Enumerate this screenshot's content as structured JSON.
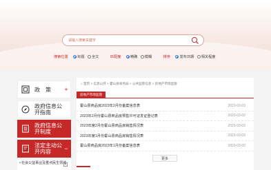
{
  "search": {
    "placeholder": "请输入搜索关键字"
  },
  "options": {
    "position": {
      "label": "搜索位置",
      "choices": [
        {
          "text": "标题",
          "checked": true
        },
        {
          "text": "全文",
          "checked": false
        }
      ]
    },
    "match": {
      "label": "匹配度",
      "choices": [
        {
          "text": "精确",
          "checked": true
        },
        {
          "text": "模糊",
          "checked": false
        }
      ]
    },
    "sort": {
      "label": "排序",
      "choices": [
        {
          "text": "发布日期",
          "checked": true
        },
        {
          "text": "相关程度",
          "checked": false
        }
      ]
    }
  },
  "sidebar": {
    "items": [
      {
        "label": "政　策",
        "sign": "+",
        "icon": "policy-icon",
        "active": false
      },
      {
        "label": "政府信息公开指南",
        "sign": "",
        "icon": "compass-icon",
        "active": false
      },
      {
        "label": "政府信息公开制度",
        "sign": "",
        "icon": "document-list-icon",
        "active": true
      },
      {
        "label": "法定主动公开内容",
        "sign": "−",
        "icon": "document-edit-icon",
        "active": true
      }
    ],
    "sub_item": "• 社会公益事业及重点民生领域"
  },
  "main": {
    "breadcrumb": "⌂ 首页 > 信息公开 > 霍山县商务局 > 公共监管信息 > 房地产市场监管",
    "tab": "房地产市场监管",
    "rows": [
      {
        "title": "霍山县商品房2023年2月份备案信息表",
        "date": "2023-03-02"
      },
      {
        "title": "2023年2月份霍山县商品房预售许可证发证登记表",
        "date": "2023-03-02"
      },
      {
        "title": "2023年度2月份霍山县商品房销售情况表",
        "date": "2023-03-02"
      },
      {
        "title": "2023年度1月份霍山县商品房销售情况表",
        "date": "2023-03-02"
      },
      {
        "title": "霍山县商品房2023年1月份备案信息表",
        "date": "2023-03-02"
      }
    ],
    "more": "更多"
  },
  "colors": {
    "accent": "#c62828",
    "radio": "#2d6fd6"
  }
}
